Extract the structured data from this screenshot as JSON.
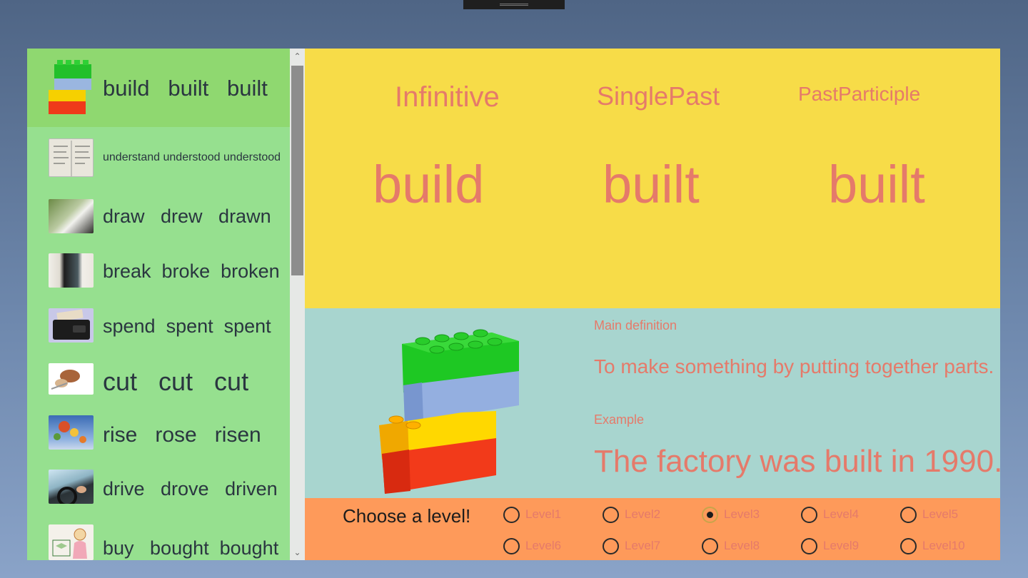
{
  "verbs": [
    {
      "text": "build   built   built"
    },
    {
      "text": "understand understood understood"
    },
    {
      "text": "draw   drew   drawn"
    },
    {
      "text": "break  broke  broken"
    },
    {
      "text": "spend  spent  spent"
    },
    {
      "text": "cut   cut   cut"
    },
    {
      "text": "rise   rose   risen"
    },
    {
      "text": "drive   drove   driven"
    },
    {
      "text": "buy   bought  bought"
    }
  ],
  "selected": {
    "headers": {
      "infinitive": "Infinitive",
      "single_past": "SinglePast",
      "past_participle": "PastParticiple"
    },
    "forms": {
      "infinitive": "build",
      "single_past": "built",
      "past_participle": "built"
    },
    "main_definition_label": "Main definition",
    "main_definition": "To make something by putting together parts.",
    "example_label": "Example",
    "example": "The factory was built in 1990."
  },
  "levels": {
    "title": "Choose a level!",
    "options": [
      "Level1",
      "Level2",
      "Level3",
      "Level4",
      "Level5",
      "Level6",
      "Level7",
      "Level8",
      "Level9",
      "Level10"
    ],
    "selected": "Level3"
  },
  "icons": {
    "scroll_up": "chevron-up-icon",
    "scroll_down": "chevron-down-icon",
    "lego": "lego-bricks-icon"
  }
}
